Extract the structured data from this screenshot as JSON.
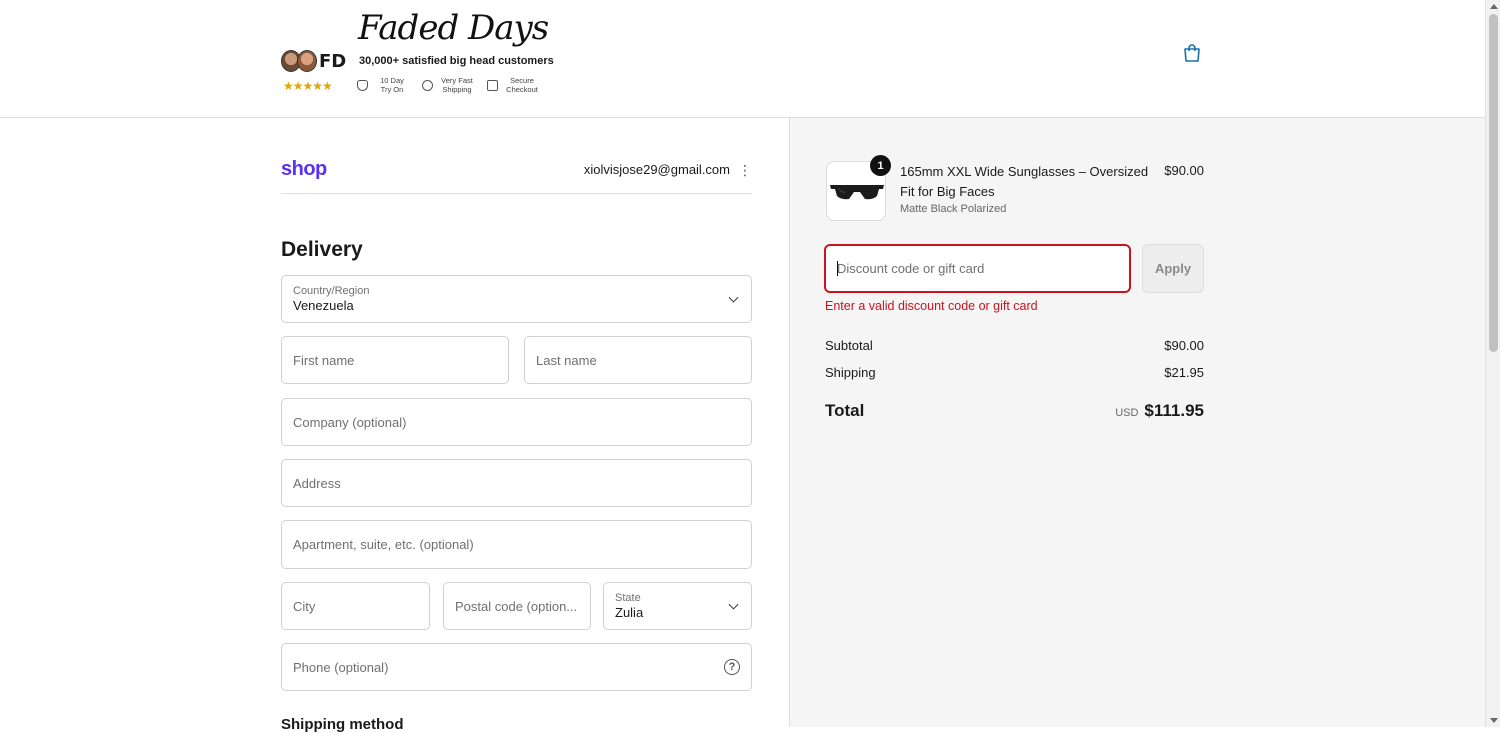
{
  "header": {
    "logo_script": "Faded Days",
    "avatar_initials": "FD",
    "stars": "★★★★★",
    "tagline": "30,000+ satisfied big head customers",
    "badges": [
      {
        "icon": "shield-check-icon",
        "label": "10 Day\nTry On"
      },
      {
        "icon": "clock-icon",
        "label": "Very Fast\nShipping"
      },
      {
        "icon": "lock-icon",
        "label": "Secure\nCheckout"
      }
    ],
    "cart_icon": "shopping-bag-icon",
    "cart_color": "#1773b0"
  },
  "account": {
    "shop_logo": "shop",
    "email": "xiolvisjose29@gmail.com",
    "menu_icon": "⋮"
  },
  "delivery": {
    "title": "Delivery",
    "country": {
      "label": "Country/Region",
      "value": "Venezuela"
    },
    "first_name": {
      "placeholder": "First name"
    },
    "last_name": {
      "placeholder": "Last name"
    },
    "company": {
      "placeholder": "Company (optional)"
    },
    "address": {
      "placeholder": "Address"
    },
    "apartment": {
      "placeholder": "Apartment, suite, etc. (optional)"
    },
    "city": {
      "placeholder": "City"
    },
    "postal": {
      "placeholder": "Postal code (option..."
    },
    "state": {
      "label": "State",
      "value": "Zulia"
    },
    "phone": {
      "placeholder": "Phone (optional)",
      "help": "?"
    },
    "shipping_method_title": "Shipping method"
  },
  "summary": {
    "product": {
      "quantity": "1",
      "title": "165mm XXL Wide Sunglasses – Oversized Fit for Big Faces",
      "variant": "Matte Black Polarized",
      "price": "$90.00"
    },
    "discount": {
      "placeholder": "Discount code or gift card",
      "apply_label": "Apply",
      "error": "Enter a valid discount code or gift card"
    },
    "subtotal_label": "Subtotal",
    "subtotal_value": "$90.00",
    "shipping_label": "Shipping",
    "shipping_value": "$21.95",
    "total_label": "Total",
    "total_currency": "USD",
    "total_value": "$111.95"
  },
  "colors": {
    "shop_purple": "#5a31f4",
    "error_red": "#c7141d",
    "summary_bg": "#f5f5f5"
  }
}
